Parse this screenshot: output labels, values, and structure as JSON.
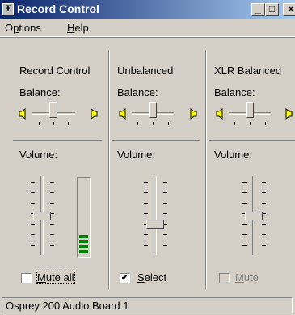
{
  "window": {
    "title": "Record Control"
  },
  "menu": [
    {
      "pre": "O",
      "acc": "p",
      "post": "tions"
    },
    {
      "pre": "",
      "acc": "H",
      "post": "elp"
    }
  ],
  "columns": [
    {
      "name": "Record Control",
      "balance_label": "Balance:",
      "volume_label": "Volume:",
      "checkbox_label_acc": "M",
      "checkbox_label_rest": "ute all",
      "checked": false,
      "disabled": false,
      "meter_segments_lit": 4
    },
    {
      "name": "Unbalanced",
      "balance_label": "Balance:",
      "volume_label": "Volume:",
      "checkbox_label_acc": "S",
      "checkbox_label_rest": "elect",
      "checked": true,
      "disabled": false
    },
    {
      "name": "XLR Balanced",
      "balance_label": "Balance:",
      "volume_label": "Volume:",
      "checkbox_label_acc": "M",
      "checkbox_label_rest": "ute",
      "checked": false,
      "disabled": true
    }
  ],
  "check_mark": "✔",
  "status": {
    "text": "Osprey 200 Audio Board 1"
  }
}
